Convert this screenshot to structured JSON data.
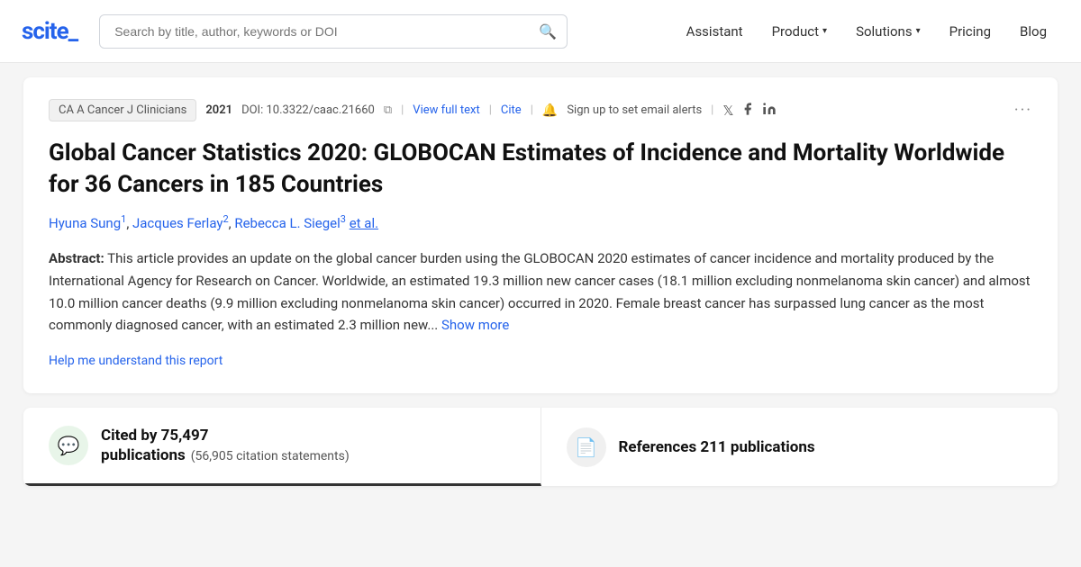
{
  "logo": {
    "text": "scite_"
  },
  "search": {
    "placeholder": "Search by title, author, keywords or DOI"
  },
  "nav": {
    "items": [
      {
        "label": "Assistant",
        "hasDropdown": false
      },
      {
        "label": "Product",
        "hasDropdown": true
      },
      {
        "label": "Solutions",
        "hasDropdown": true
      },
      {
        "label": "Pricing",
        "hasDropdown": false
      },
      {
        "label": "Blog",
        "hasDropdown": false
      }
    ]
  },
  "article": {
    "journal": "CA A Cancer J Clinicians",
    "year": "2021",
    "doi": "DOI: 10.3322/caac.21660",
    "view_full_text": "View full text",
    "cite": "Cite",
    "alert_text": "Sign up to set email alerts",
    "title": "Global Cancer Statistics 2020: GLOBOCAN Estimates of Incidence and Mortality Worldwide for 36 Cancers in 185 Countries",
    "authors": [
      {
        "name": "Hyuna Sung",
        "sup": "1"
      },
      {
        "name": "Jacques Ferlay",
        "sup": "2"
      },
      {
        "name": "Rebecca L. Siegel",
        "sup": "3"
      }
    ],
    "et_al": "et al.",
    "abstract_label": "Abstract:",
    "abstract_text": "This article provides an update on the global cancer burden using the GLOBOCAN 2020 estimates of cancer incidence and mortality produced by the International Agency for Research on Cancer. Worldwide, an estimated 19.3 million new cancer cases (18.1 million excluding nonmelanoma skin cancer) and almost 10.0 million cancer deaths (9.9 million excluding nonmelanoma skin cancer) occurred in 2020. Female breast cancer has surpassed lung cancer as the most commonly diagnosed cancer, with an estimated 2.3 million new...",
    "show_more": "Show more",
    "help_link": "Help me understand this report",
    "more_icon": "···"
  },
  "stats": {
    "cited_by_label": "Cited by 75,497",
    "cited_by_sub": "publications",
    "citation_statements": "(56,905 citation statements)",
    "references_label": "References 211 publications",
    "icons": {
      "chat": "💬",
      "doc": "📄"
    }
  }
}
